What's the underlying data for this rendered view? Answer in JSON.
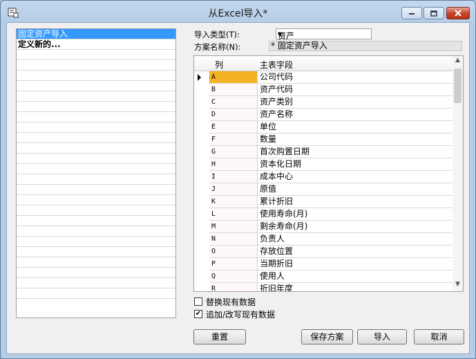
{
  "window": {
    "title": "从Excel导入*"
  },
  "left_list": {
    "items": [
      {
        "label": "固定资产导入",
        "selected": true
      },
      {
        "label": "定义新的...",
        "bold": true
      }
    ],
    "blank_rows": 24
  },
  "form": {
    "import_type_label": "导入类型(T):",
    "import_type_value": "资产",
    "scheme_name_label": "方案名称(N):",
    "scheme_name_value": "* 固定资产导入"
  },
  "grid": {
    "headers": {
      "col": "列",
      "field": "主表字段"
    },
    "rows": [
      {
        "col": "A",
        "field": "公司代码"
      },
      {
        "col": "B",
        "field": "资产代码"
      },
      {
        "col": "C",
        "field": "资产类别"
      },
      {
        "col": "D",
        "field": "资产名称"
      },
      {
        "col": "E",
        "field": "单位"
      },
      {
        "col": "F",
        "field": "数量"
      },
      {
        "col": "G",
        "field": "首次购置日期"
      },
      {
        "col": "H",
        "field": "资本化日期"
      },
      {
        "col": "I",
        "field": "成本中心"
      },
      {
        "col": "J",
        "field": "原值"
      },
      {
        "col": "K",
        "field": "累计折旧"
      },
      {
        "col": "L",
        "field": "使用寿命(月)"
      },
      {
        "col": "M",
        "field": "剩余寿命(月)"
      },
      {
        "col": "N",
        "field": "负责人"
      },
      {
        "col": "O",
        "field": "存放位置"
      },
      {
        "col": "P",
        "field": "当期折旧"
      },
      {
        "col": "Q",
        "field": "使用人"
      },
      {
        "col": "R",
        "field": "折旧年度"
      }
    ]
  },
  "options": {
    "replace_label": "替换现有数据",
    "replace_checked": false,
    "append_label": "追加/改写现有数据",
    "append_checked": true
  },
  "buttons": {
    "reset": "重置",
    "save_scheme": "保存方案",
    "import": "导入",
    "cancel": "取消"
  },
  "colors": {
    "selection": "#3399ff",
    "current_cell": "#f5b324"
  }
}
